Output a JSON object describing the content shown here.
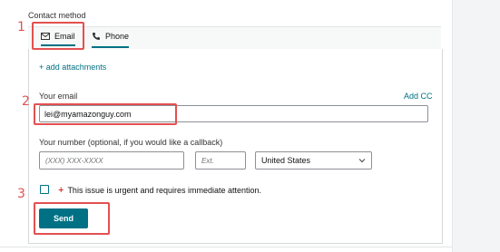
{
  "contact": {
    "section_label": "Contact method",
    "tabs": [
      {
        "label": "Email",
        "icon": "envelope-icon",
        "selected": true
      },
      {
        "label": "Phone",
        "icon": "phone-icon",
        "selected": false
      }
    ]
  },
  "form": {
    "add_attachments": "+ add attachments",
    "email_label": "Your email",
    "add_cc": "Add CC",
    "email_value": "lei@myamazonguy.com",
    "number_label": "Your number (optional, if you would like a callback)",
    "phone_placeholder": "(XXX) XXX-XXXX",
    "ext_placeholder": "Ext.",
    "country_value": "United States",
    "urgent_text": "This issue is urgent and requires immediate attention.",
    "urgent_marker": "+",
    "send_label": "Send"
  },
  "annotations": {
    "steps": [
      "1",
      "2",
      "3"
    ],
    "color": "#e45050"
  },
  "colors": {
    "accent": "#007185",
    "urgent_plus": "#c40000"
  }
}
